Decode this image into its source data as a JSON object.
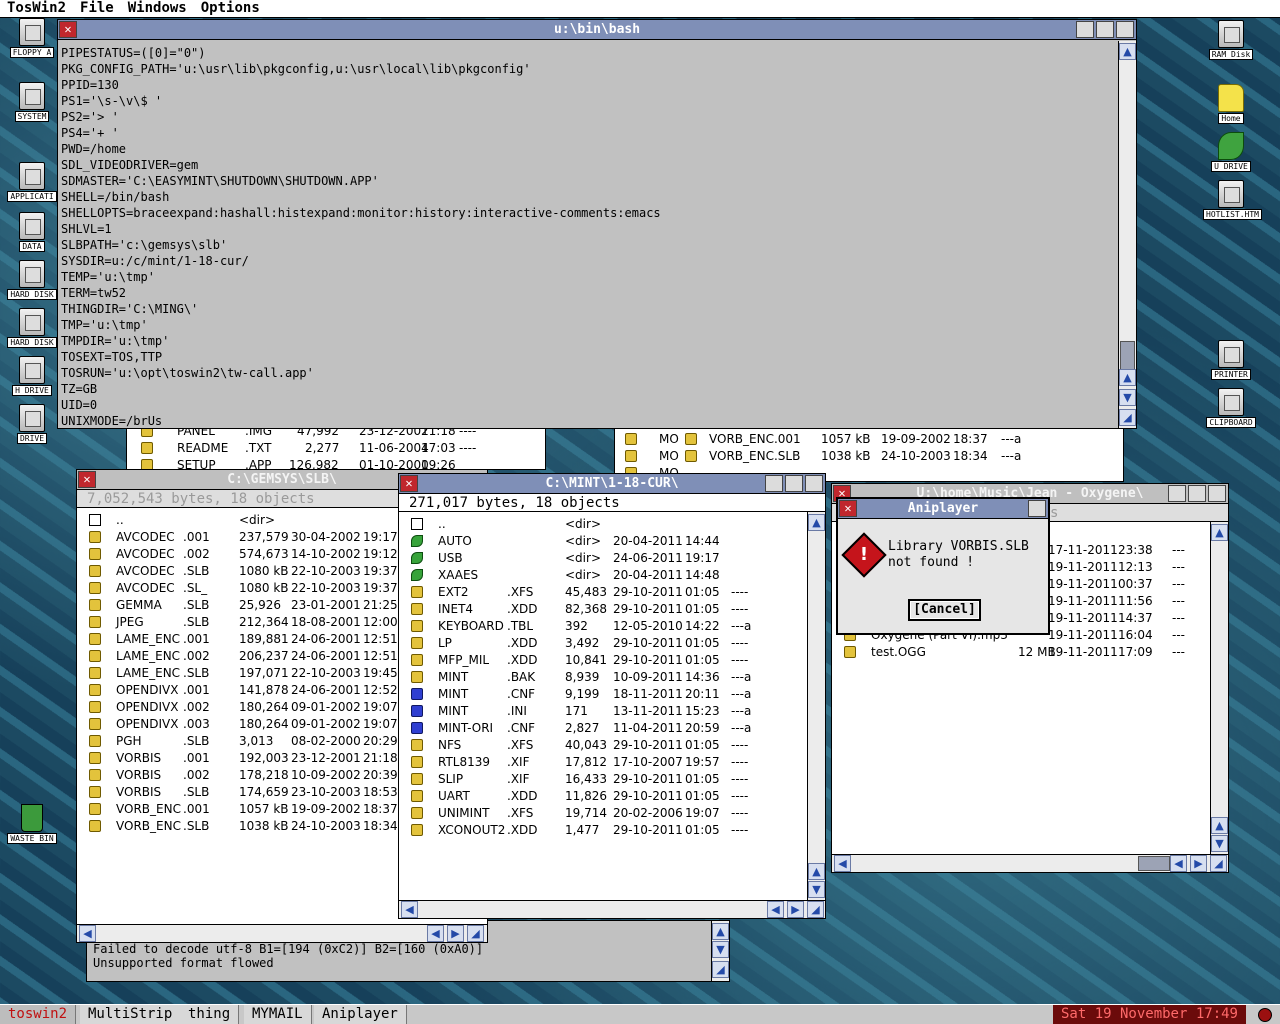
{
  "menubar": [
    "TosWin2",
    "File",
    "Windows",
    "Options"
  ],
  "desktop_icons_left": [
    "FLOPPY A",
    "SYSTEM",
    "APPLICATI",
    "DATA",
    "HARD DISK",
    "HARD DISK",
    "H DRIVE",
    "DRIVE",
    "WASTE BIN"
  ],
  "desktop_icons_right": [
    "RAM Disk",
    "Home",
    "U DRIVE",
    "HOTLIST.HTM",
    "PRINTER",
    "CLIPBOARD"
  ],
  "terminal": {
    "title": "u:\\bin\\bash",
    "lines": [
      "PIPESTATUS=([0]=\"0\")",
      "PKG_CONFIG_PATH='u:\\usr\\lib\\pkgconfig,u:\\usr\\local\\lib\\pkgconfig'",
      "PPID=130",
      "PS1='\\s-\\v\\$ '",
      "PS2='> '",
      "PS4='+ '",
      "PWD=/home",
      "SDL_VIDEODRIVER=gem",
      "SDMASTER='C:\\EASYMINT\\SHUTDOWN\\SHUTDOWN.APP'",
      "SHELL=/bin/bash",
      "SHELLOPTS=braceexpand:hashall:histexpand:monitor:history:interactive-comments:emacs",
      "SHLVL=1",
      "SLBPATH='c:\\gemsys\\slb'",
      "SYSDIR=u:/c/mint/1-18-cur/",
      "TEMP='u:\\tmp'",
      "TERM=tw52",
      "THINGDIR='C:\\MING\\'",
      "TMP='u:\\tmp'",
      "TMPDIR='u:\\tmp'",
      "TOSEXT=TOS,TTP",
      "TOSRUN='u:\\opt\\toswin2\\tw-call.app'",
      "TZ=GB",
      "UID=0",
      "UNIXMODE=/brUs"
    ]
  },
  "bg_window_top": {
    "rows": [
      {
        "name": "PANEL",
        "ext": ".IMG",
        "size": "47,992",
        "date": "23-12-2001",
        "time": "21:18",
        "attr": "----"
      },
      {
        "name": "README",
        "ext": ".TXT",
        "size": "2,277",
        "date": "11-06-2004",
        "time": "17:03",
        "attr": "----"
      },
      {
        "name": "SETUP",
        "ext": ".APP",
        "size": "126,982",
        "date": "01-10-2000",
        "time": "19:26",
        "attr": ""
      }
    ]
  },
  "bg_window_mid": {
    "labels": [
      "MO",
      "MO",
      "MO"
    ],
    "rows": [
      {
        "name": "VORB_ENC.001",
        "size": "1057 kB",
        "date": "19-09-2002",
        "time": "18:37",
        "attr": "---a"
      },
      {
        "name": "VORB_ENC.SLB",
        "size": "1038 kB",
        "date": "24-10-2003",
        "time": "18:34",
        "attr": "---a"
      }
    ]
  },
  "gemsys_window": {
    "title": "C:\\GEMSYS\\SLB\\",
    "info": "7,052,543 bytes, 18 objects",
    "rows": [
      {
        "icon": "up",
        "name": "..",
        "ext": "",
        "size": "<dir>",
        "date": "",
        "time": ""
      },
      {
        "icon": "app",
        "name": "AVCODEC",
        "ext": ".001",
        "size": "237,579",
        "date": "30-04-2002",
        "time": "19:17"
      },
      {
        "icon": "app",
        "name": "AVCODEC",
        "ext": ".002",
        "size": "574,673",
        "date": "14-10-2002",
        "time": "19:12"
      },
      {
        "icon": "app",
        "name": "AVCODEC",
        "ext": ".SLB",
        "size": "1080 kB",
        "date": "22-10-2003",
        "time": "19:37"
      },
      {
        "icon": "app",
        "name": "AVCODEC",
        "ext": ".SL_",
        "size": "1080 kB",
        "date": "22-10-2003",
        "time": "19:37"
      },
      {
        "icon": "app",
        "name": "GEMMA",
        "ext": ".SLB",
        "size": "25,926",
        "date": "23-01-2001",
        "time": "21:25"
      },
      {
        "icon": "app",
        "name": "JPEG",
        "ext": ".SLB",
        "size": "212,364",
        "date": "18-08-2001",
        "time": "12:00"
      },
      {
        "icon": "app",
        "name": "LAME_ENC",
        "ext": ".001",
        "size": "189,881",
        "date": "24-06-2001",
        "time": "12:51"
      },
      {
        "icon": "app",
        "name": "LAME_ENC",
        "ext": ".002",
        "size": "206,237",
        "date": "24-06-2001",
        "time": "12:51"
      },
      {
        "icon": "app",
        "name": "LAME_ENC",
        "ext": ".SLB",
        "size": "197,071",
        "date": "22-10-2003",
        "time": "19:45"
      },
      {
        "icon": "app",
        "name": "OPENDIVX",
        "ext": ".001",
        "size": "141,878",
        "date": "24-06-2001",
        "time": "12:52"
      },
      {
        "icon": "app",
        "name": "OPENDIVX",
        "ext": ".002",
        "size": "180,264",
        "date": "09-01-2002",
        "time": "19:07"
      },
      {
        "icon": "app",
        "name": "OPENDIVX",
        "ext": ".003",
        "size": "180,264",
        "date": "09-01-2002",
        "time": "19:07"
      },
      {
        "icon": "app",
        "name": "PGH",
        "ext": ".SLB",
        "size": "3,013",
        "date": "08-02-2000",
        "time": "20:29"
      },
      {
        "icon": "app",
        "name": "VORBIS",
        "ext": ".001",
        "size": "192,003",
        "date": "23-12-2001",
        "time": "21:18"
      },
      {
        "icon": "app",
        "name": "VORBIS",
        "ext": ".002",
        "size": "178,218",
        "date": "10-09-2002",
        "time": "20:39"
      },
      {
        "icon": "app",
        "name": "VORBIS",
        "ext": ".SLB",
        "size": "174,659",
        "date": "23-10-2003",
        "time": "18:53"
      },
      {
        "icon": "app",
        "name": "VORB_ENC",
        "ext": ".001",
        "size": "1057 kB",
        "date": "19-09-2002",
        "time": "18:37"
      },
      {
        "icon": "app",
        "name": "VORB_ENC",
        "ext": ".SLB",
        "size": "1038 kB",
        "date": "24-10-2003",
        "time": "18:34"
      }
    ]
  },
  "mint_window": {
    "title": "C:\\MINT\\1-18-CUR\\",
    "info": "271,017 bytes, 18 objects",
    "rows": [
      {
        "icon": "up",
        "name": "..",
        "ext": "",
        "size": "<dir>",
        "date": "",
        "time": "",
        "attr": ""
      },
      {
        "icon": "dir",
        "name": "AUTO",
        "ext": "",
        "size": "<dir>",
        "date": "20-04-2011",
        "time": "14:44",
        "attr": ""
      },
      {
        "icon": "dir",
        "name": "USB",
        "ext": "",
        "size": "<dir>",
        "date": "24-06-2011",
        "time": "19:17",
        "attr": ""
      },
      {
        "icon": "dir",
        "name": "XAAES",
        "ext": "",
        "size": "<dir>",
        "date": "20-04-2011",
        "time": "14:48",
        "attr": ""
      },
      {
        "icon": "app",
        "name": "EXT2",
        "ext": ".XFS",
        "size": "45,483",
        "date": "29-10-2011",
        "time": "01:05",
        "attr": "----"
      },
      {
        "icon": "app",
        "name": "INET4",
        "ext": ".XDD",
        "size": "82,368",
        "date": "29-10-2011",
        "time": "01:05",
        "attr": "----"
      },
      {
        "icon": "app",
        "name": "KEYBOARD",
        "ext": ".TBL",
        "size": "392",
        "date": "12-05-2010",
        "time": "14:22",
        "attr": "---a"
      },
      {
        "icon": "app",
        "name": "LP",
        "ext": ".XDD",
        "size": "3,492",
        "date": "29-10-2011",
        "time": "01:05",
        "attr": "----"
      },
      {
        "icon": "app",
        "name": "MFP_MIL",
        "ext": ".XDD",
        "size": "10,841",
        "date": "29-10-2011",
        "time": "01:05",
        "attr": "----"
      },
      {
        "icon": "app",
        "name": "MINT",
        "ext": ".BAK",
        "size": "8,939",
        "date": "10-09-2011",
        "time": "14:36",
        "attr": "---a"
      },
      {
        "icon": "cfg",
        "name": "MINT",
        "ext": ".CNF",
        "size": "9,199",
        "date": "18-11-2011",
        "time": "20:11",
        "attr": "---a"
      },
      {
        "icon": "cfg",
        "name": "MINT",
        "ext": ".INI",
        "size": "171",
        "date": "13-11-2011",
        "time": "15:23",
        "attr": "---a"
      },
      {
        "icon": "cfg",
        "name": "MINT-ORI",
        "ext": ".CNF",
        "size": "2,827",
        "date": "11-04-2011",
        "time": "20:59",
        "attr": "---a"
      },
      {
        "icon": "app",
        "name": "NFS",
        "ext": ".XFS",
        "size": "40,043",
        "date": "29-10-2011",
        "time": "01:05",
        "attr": "----"
      },
      {
        "icon": "app",
        "name": "RTL8139",
        "ext": ".XIF",
        "size": "17,812",
        "date": "17-10-2007",
        "time": "19:57",
        "attr": "----"
      },
      {
        "icon": "app",
        "name": "SLIP",
        "ext": ".XIF",
        "size": "16,433",
        "date": "29-10-2011",
        "time": "01:05",
        "attr": "----"
      },
      {
        "icon": "app",
        "name": "UART",
        "ext": ".XDD",
        "size": "11,826",
        "date": "29-10-2011",
        "time": "01:05",
        "attr": "----"
      },
      {
        "icon": "app",
        "name": "UNIMINT",
        "ext": ".XFS",
        "size": "19,714",
        "date": "20-02-2006",
        "time": "19:07",
        "attr": "----"
      },
      {
        "icon": "app",
        "name": "XCONOUT2",
        "ext": ".XDD",
        "size": "1,477",
        "date": "29-10-2011",
        "time": "01:05",
        "attr": "----"
      }
    ]
  },
  "music_window": {
    "title": "U:\\home\\Music\\Jean - Oxygene\\",
    "info_fragment": "s",
    "rows": [
      {
        "name": "",
        "size": "B",
        "date": "17-11-2011",
        "time": "23:38",
        "attr": "---"
      },
      {
        "name": "",
        "size": "B",
        "date": "19-11-2011",
        "time": "12:13",
        "attr": "---"
      },
      {
        "name": "",
        "size": "B",
        "date": "19-11-2011",
        "time": "00:37",
        "attr": "---"
      },
      {
        "name": "",
        "size": "B",
        "date": "19-11-2011",
        "time": "11:56",
        "attr": "---"
      },
      {
        "name": "",
        "size": "B",
        "date": "19-11-2011",
        "time": "14:37",
        "attr": "---"
      },
      {
        "name": "Oxygene (Part VI).mp3",
        "size": "",
        "date": "19-11-2011",
        "time": "16:04",
        "attr": "---"
      },
      {
        "name": "test.OGG",
        "size": "12 MB",
        "date": "19-11-2011",
        "time": "17:09",
        "attr": "---"
      }
    ]
  },
  "dialog": {
    "title": "Aniplayer",
    "message_line1": "Library VORBIS.SLB",
    "message_line2": "not found !",
    "button": "[Cancel]"
  },
  "bottom_window": {
    "line1": "Failed to decode utf-8 B1=[194 (0xC2)] B2=[160 (0xA0)]",
    "line2": "Unsupported format flowed"
  },
  "taskbar": {
    "items": [
      "toswin2",
      "MultiStrip",
      "thing",
      "MYMAIL",
      "Aniplayer"
    ],
    "clock": "Sat 19 November 17:49"
  }
}
